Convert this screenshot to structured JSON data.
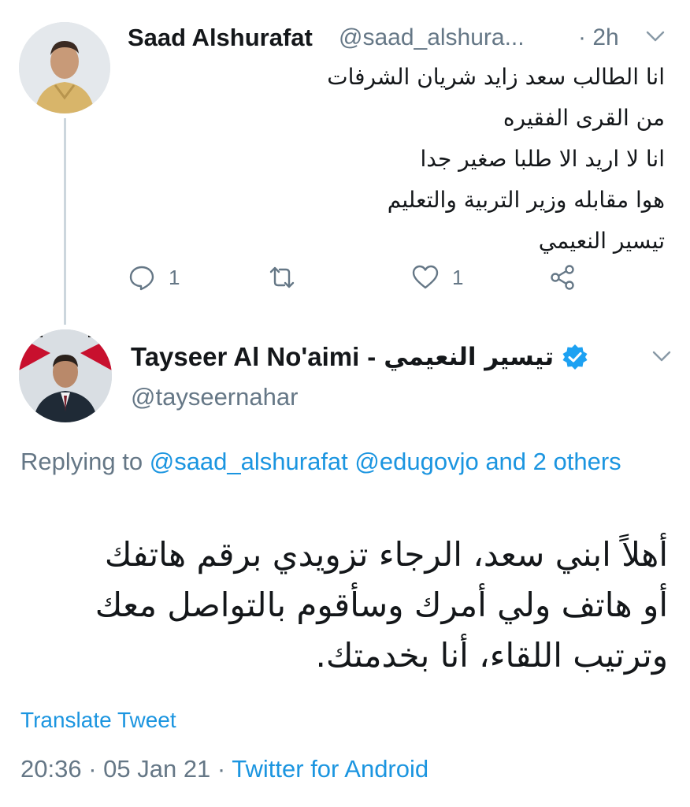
{
  "tweet1": {
    "author_name": "Saad Alshurafat",
    "handle": "@saad_alshura...",
    "time": "· 2h",
    "body_lines": [
      "انا الطالب سعد زايد شريان الشرفات",
      "من القرى الفقيره",
      "انا لا اريد الا طلبا صغير جدا",
      "هوا مقابله وزير التربية والتعليم",
      "تيسير النعيمي"
    ],
    "reply_count": "1",
    "like_count": "1"
  },
  "tweet2": {
    "author_name": "Tayseer Al No'aimi",
    "name_separator": "-",
    "author_name_arabic": "تيسير النعيمي",
    "handle": "@tayseernahar",
    "replying_prefix": "Replying to",
    "replying_to": "@saad_alshurafat @edugovjo and 2 others",
    "body_lines": [
      "أهلاً ابني سعد، الرجاء تزويدي برقم هاتفك",
      "أو هاتف ولي أمرك وسأقوم بالتواصل معك",
      "وترتيب اللقاء، أنا بخدمتك."
    ],
    "translate_label": "Translate Tweet",
    "timestamp": "20:36 · 05 Jan 21 ·",
    "source": "Twitter for Android"
  },
  "icons": {
    "reply": "reply-icon",
    "retweet": "retweet-icon",
    "like": "heart-icon",
    "share": "share-icon",
    "verified": "verified-badge-icon",
    "menu": "chevron-down-icon"
  },
  "colors": {
    "link": "#1b95e0",
    "secondary_text": "#657786",
    "primary_text": "#14171a",
    "verified": "#1da1f2",
    "thread_line": "#ccd6dd"
  }
}
